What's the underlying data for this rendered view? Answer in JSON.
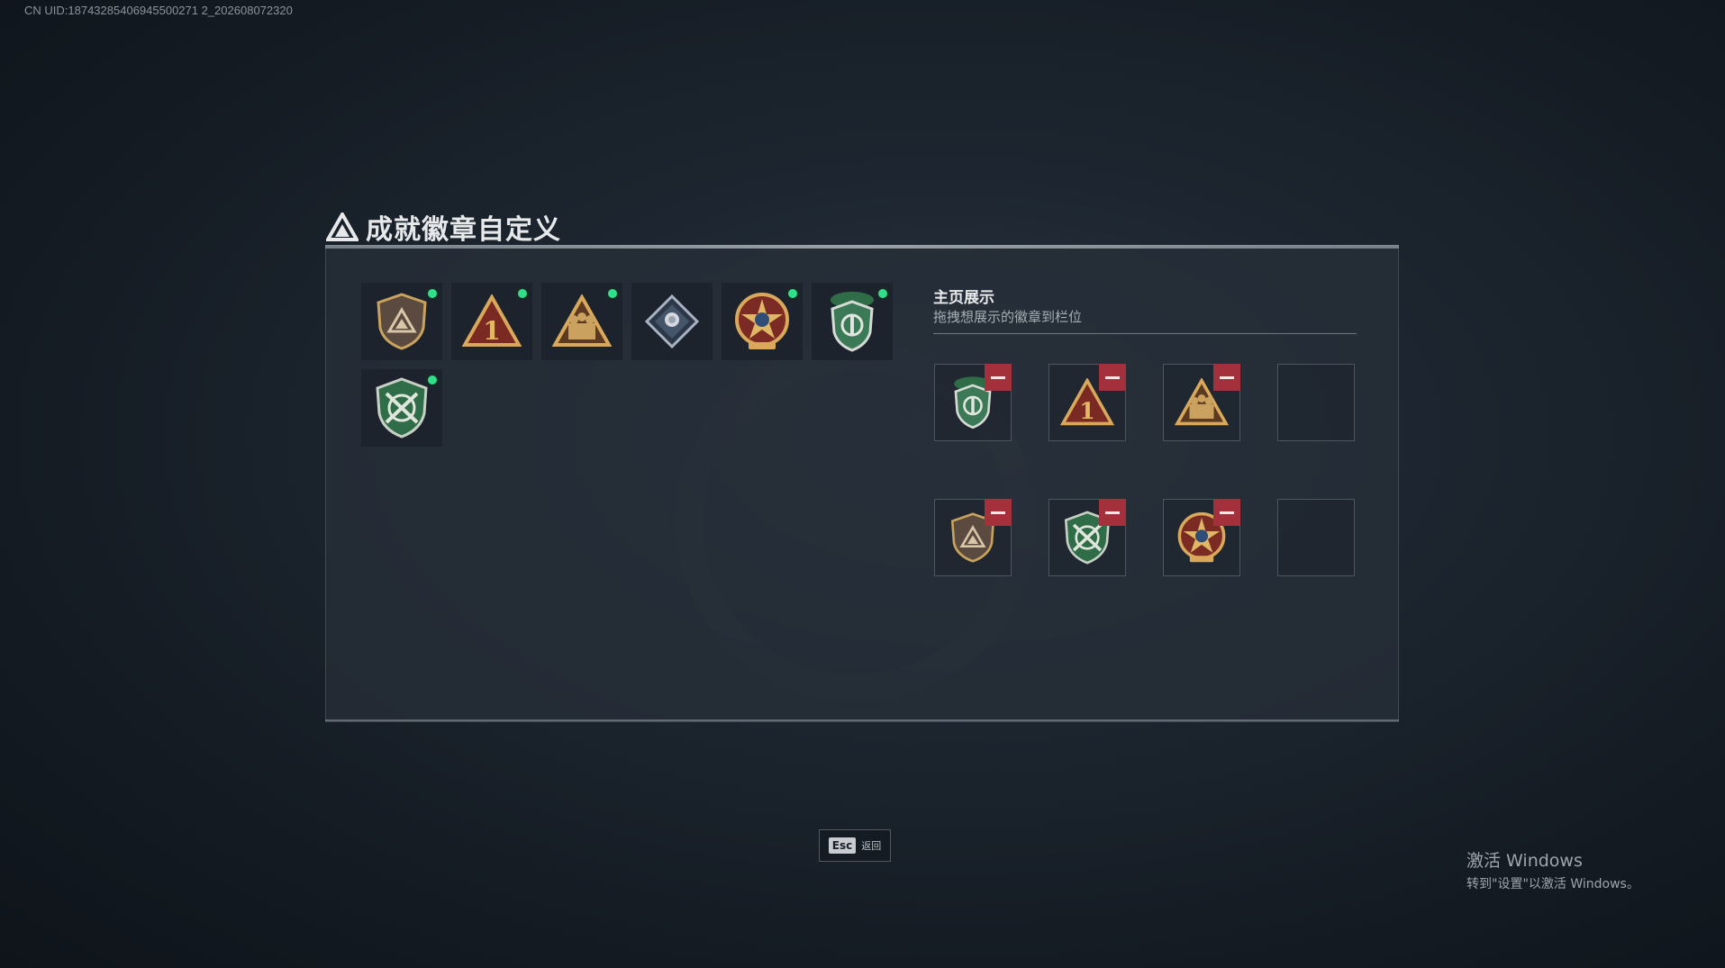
{
  "uid_text": "CN UID:18743285406945500271 2_202608072320",
  "title": "成就徽章自定义",
  "badges": [
    {
      "icon": "shield-triangle-badge-icon",
      "new": true
    },
    {
      "icon": "triangle-number-one-badge-icon",
      "new": true
    },
    {
      "icon": "triangle-soldiers-badge-icon",
      "new": true
    },
    {
      "icon": "diamond-rose-badge-icon",
      "new": false
    },
    {
      "icon": "star-medal-badge-icon",
      "new": true
    },
    {
      "icon": "green-beret-shield-badge-icon",
      "new": true
    },
    {
      "icon": "green-crossed-rifles-badge-icon",
      "new": true
    }
  ],
  "showcase": {
    "title": "主页展示",
    "subtitle": "拖拽想展示的徽章到栏位",
    "slots": [
      {
        "icon": "green-beret-shield-badge-icon"
      },
      {
        "icon": "triangle-number-one-badge-icon"
      },
      {
        "icon": "triangle-soldiers-badge-icon"
      },
      {
        "icon": null
      },
      {
        "icon": "shield-triangle-badge-icon"
      },
      {
        "icon": "green-crossed-rifles-badge-icon"
      },
      {
        "icon": "star-medal-badge-icon"
      },
      {
        "icon": null
      }
    ]
  },
  "footer": {
    "esc_key": "Esc",
    "esc_label": "返回"
  },
  "windows_watermark": {
    "title": "激活 Windows",
    "subtitle": "转到\"设置\"以激活 Windows。"
  },
  "colors": {
    "new_dot": "#2ee08a",
    "remove_button": "#a3303a",
    "gold": "#c9a25c",
    "green": "#2f6d48"
  }
}
